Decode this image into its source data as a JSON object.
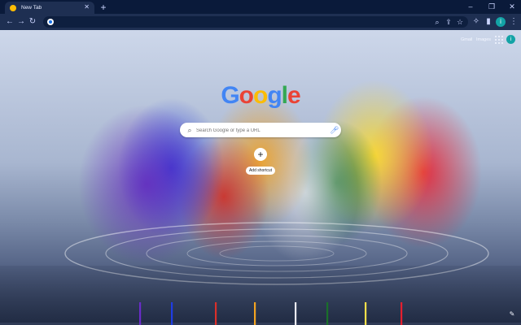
{
  "browser": {
    "tab": {
      "title": "New Tab"
    },
    "omnibox": {
      "value": ""
    }
  },
  "ntp": {
    "top_links": {
      "gmail": "Gmail",
      "images": "Images"
    },
    "avatar_initial": "i",
    "logo": {
      "text": "Google",
      "colors": [
        "#4285f4",
        "#ea4335",
        "#fbbc05",
        "#4285f4",
        "#34a853",
        "#ea4335"
      ]
    },
    "search": {
      "placeholder": "Search Google or type a URL"
    },
    "shortcut": {
      "label": "Add shortcut"
    }
  },
  "icons": {
    "tab_favicon": "chrome-icon",
    "tab_close": "close-icon",
    "new_tab": "plus-icon",
    "back": "arrow-left-icon",
    "forward": "arrow-right-icon",
    "reload": "reload-icon",
    "search": "search-icon",
    "share": "share-icon",
    "bookmark": "star-icon",
    "extensions": "puzzle-icon",
    "side_panel": "side-panel-icon",
    "menu": "kebab-menu-icon",
    "apps": "apps-grid-icon",
    "mic": "mic-icon",
    "customize": "pencil-icon"
  }
}
